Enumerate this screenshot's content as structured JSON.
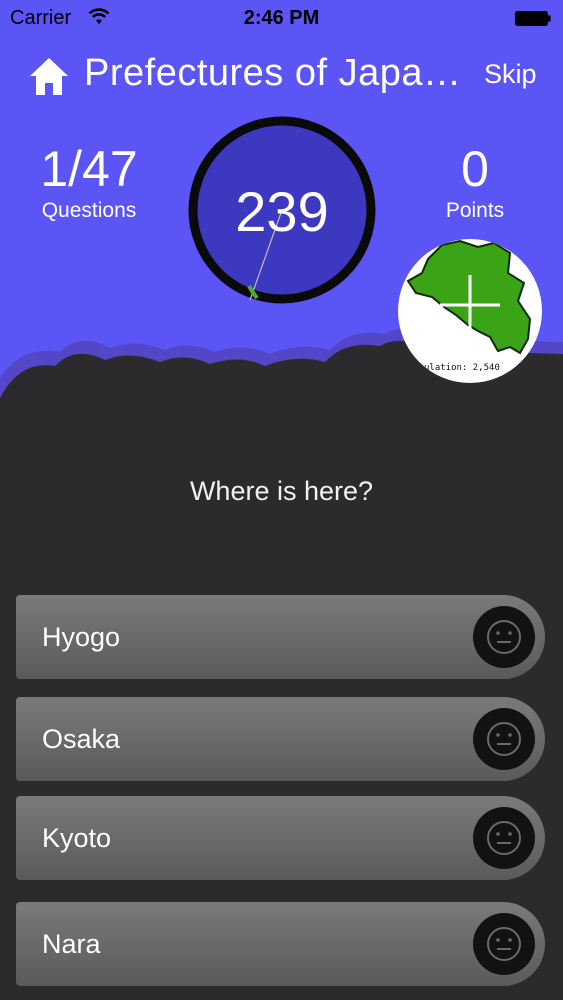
{
  "status_bar": {
    "carrier": "Carrier",
    "time": "2:46 PM"
  },
  "header": {
    "title": "Prefectures of Japa…",
    "skip_label": "Skip"
  },
  "stats": {
    "questions_value": "1/47",
    "questions_label": "Questions",
    "timer_value": "239",
    "points_value": "0",
    "points_label": "Points"
  },
  "map": {
    "info_line_1": "ulation:  2,540 ",
    "info_line_2": "               "
  },
  "question": "Where is here?",
  "answers": [
    {
      "label": "Hyogo"
    },
    {
      "label": "Osaka"
    },
    {
      "label": "Kyoto"
    },
    {
      "label": "Nara"
    }
  ],
  "colors": {
    "top_background": "#5b55f5",
    "bottom_background": "#2b2b2d",
    "timer_fill": "#3d38c0",
    "timer_hand": "#4caf3c",
    "map_fill": "#3aa316"
  },
  "icons": [
    "home-icon",
    "wifi-icon",
    "battery-icon",
    "neutral-face-icon"
  ]
}
